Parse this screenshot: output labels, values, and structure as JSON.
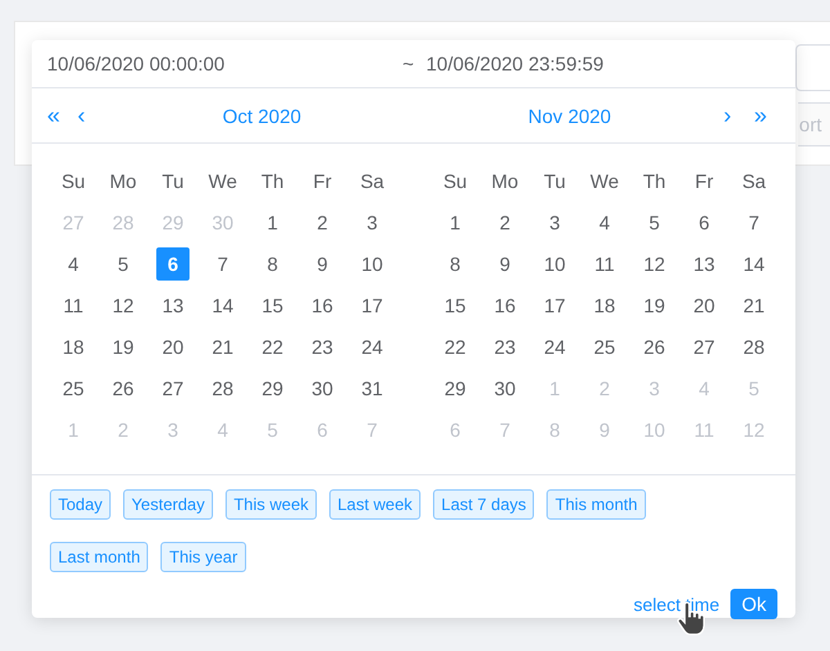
{
  "background": {
    "button_text": "ort"
  },
  "picker": {
    "start": "10/06/2020 00:00:00",
    "separator": "~",
    "end": "10/06/2020 23:59:59",
    "nav": {
      "prev_year": "«",
      "prev_month": "‹",
      "next_month": "›",
      "next_year": "»"
    },
    "months": [
      {
        "title": "Oct 2020",
        "weekdays": [
          "Su",
          "Mo",
          "Tu",
          "We",
          "Th",
          "Fr",
          "Sa"
        ],
        "weeks": [
          [
            {
              "text": "27",
              "outside": true,
              "selected": false
            },
            {
              "text": "28",
              "outside": true,
              "selected": false
            },
            {
              "text": "29",
              "outside": true,
              "selected": false
            },
            {
              "text": "30",
              "outside": true,
              "selected": false
            },
            {
              "text": "1",
              "outside": false,
              "selected": false
            },
            {
              "text": "2",
              "outside": false,
              "selected": false
            },
            {
              "text": "3",
              "outside": false,
              "selected": false
            }
          ],
          [
            {
              "text": "4",
              "outside": false,
              "selected": false
            },
            {
              "text": "5",
              "outside": false,
              "selected": false
            },
            {
              "text": "6",
              "outside": false,
              "selected": true
            },
            {
              "text": "7",
              "outside": false,
              "selected": false
            },
            {
              "text": "8",
              "outside": false,
              "selected": false
            },
            {
              "text": "9",
              "outside": false,
              "selected": false
            },
            {
              "text": "10",
              "outside": false,
              "selected": false
            }
          ],
          [
            {
              "text": "11",
              "outside": false,
              "selected": false
            },
            {
              "text": "12",
              "outside": false,
              "selected": false
            },
            {
              "text": "13",
              "outside": false,
              "selected": false
            },
            {
              "text": "14",
              "outside": false,
              "selected": false
            },
            {
              "text": "15",
              "outside": false,
              "selected": false
            },
            {
              "text": "16",
              "outside": false,
              "selected": false
            },
            {
              "text": "17",
              "outside": false,
              "selected": false
            }
          ],
          [
            {
              "text": "18",
              "outside": false,
              "selected": false
            },
            {
              "text": "19",
              "outside": false,
              "selected": false
            },
            {
              "text": "20",
              "outside": false,
              "selected": false
            },
            {
              "text": "21",
              "outside": false,
              "selected": false
            },
            {
              "text": "22",
              "outside": false,
              "selected": false
            },
            {
              "text": "23",
              "outside": false,
              "selected": false
            },
            {
              "text": "24",
              "outside": false,
              "selected": false
            }
          ],
          [
            {
              "text": "25",
              "outside": false,
              "selected": false
            },
            {
              "text": "26",
              "outside": false,
              "selected": false
            },
            {
              "text": "27",
              "outside": false,
              "selected": false
            },
            {
              "text": "28",
              "outside": false,
              "selected": false
            },
            {
              "text": "29",
              "outside": false,
              "selected": false
            },
            {
              "text": "30",
              "outside": false,
              "selected": false
            },
            {
              "text": "31",
              "outside": false,
              "selected": false
            }
          ],
          [
            {
              "text": "1",
              "outside": true,
              "selected": false
            },
            {
              "text": "2",
              "outside": true,
              "selected": false
            },
            {
              "text": "3",
              "outside": true,
              "selected": false
            },
            {
              "text": "4",
              "outside": true,
              "selected": false
            },
            {
              "text": "5",
              "outside": true,
              "selected": false
            },
            {
              "text": "6",
              "outside": true,
              "selected": false
            },
            {
              "text": "7",
              "outside": true,
              "selected": false
            }
          ]
        ]
      },
      {
        "title": "Nov 2020",
        "weekdays": [
          "Su",
          "Mo",
          "Tu",
          "We",
          "Th",
          "Fr",
          "Sa"
        ],
        "weeks": [
          [
            {
              "text": "1",
              "outside": false,
              "selected": false
            },
            {
              "text": "2",
              "outside": false,
              "selected": false
            },
            {
              "text": "3",
              "outside": false,
              "selected": false
            },
            {
              "text": "4",
              "outside": false,
              "selected": false
            },
            {
              "text": "5",
              "outside": false,
              "selected": false
            },
            {
              "text": "6",
              "outside": false,
              "selected": false
            },
            {
              "text": "7",
              "outside": false,
              "selected": false
            }
          ],
          [
            {
              "text": "8",
              "outside": false,
              "selected": false
            },
            {
              "text": "9",
              "outside": false,
              "selected": false
            },
            {
              "text": "10",
              "outside": false,
              "selected": false
            },
            {
              "text": "11",
              "outside": false,
              "selected": false
            },
            {
              "text": "12",
              "outside": false,
              "selected": false
            },
            {
              "text": "13",
              "outside": false,
              "selected": false
            },
            {
              "text": "14",
              "outside": false,
              "selected": false
            }
          ],
          [
            {
              "text": "15",
              "outside": false,
              "selected": false
            },
            {
              "text": "16",
              "outside": false,
              "selected": false
            },
            {
              "text": "17",
              "outside": false,
              "selected": false
            },
            {
              "text": "18",
              "outside": false,
              "selected": false
            },
            {
              "text": "19",
              "outside": false,
              "selected": false
            },
            {
              "text": "20",
              "outside": false,
              "selected": false
            },
            {
              "text": "21",
              "outside": false,
              "selected": false
            }
          ],
          [
            {
              "text": "22",
              "outside": false,
              "selected": false
            },
            {
              "text": "23",
              "outside": false,
              "selected": false
            },
            {
              "text": "24",
              "outside": false,
              "selected": false
            },
            {
              "text": "25",
              "outside": false,
              "selected": false
            },
            {
              "text": "26",
              "outside": false,
              "selected": false
            },
            {
              "text": "27",
              "outside": false,
              "selected": false
            },
            {
              "text": "28",
              "outside": false,
              "selected": false
            }
          ],
          [
            {
              "text": "29",
              "outside": false,
              "selected": false
            },
            {
              "text": "30",
              "outside": false,
              "selected": false
            },
            {
              "text": "1",
              "outside": true,
              "selected": false
            },
            {
              "text": "2",
              "outside": true,
              "selected": false
            },
            {
              "text": "3",
              "outside": true,
              "selected": false
            },
            {
              "text": "4",
              "outside": true,
              "selected": false
            },
            {
              "text": "5",
              "outside": true,
              "selected": false
            }
          ],
          [
            {
              "text": "6",
              "outside": true,
              "selected": false
            },
            {
              "text": "7",
              "outside": true,
              "selected": false
            },
            {
              "text": "8",
              "outside": true,
              "selected": false
            },
            {
              "text": "9",
              "outside": true,
              "selected": false
            },
            {
              "text": "10",
              "outside": true,
              "selected": false
            },
            {
              "text": "11",
              "outside": true,
              "selected": false
            },
            {
              "text": "12",
              "outside": true,
              "selected": false
            }
          ]
        ]
      }
    ],
    "presets": [
      "Today",
      "Yesterday",
      "This week",
      "Last week",
      "Last 7 days",
      "This month",
      "Last month",
      "This year"
    ],
    "footer": {
      "link": "select time",
      "ok": "Ok"
    }
  }
}
